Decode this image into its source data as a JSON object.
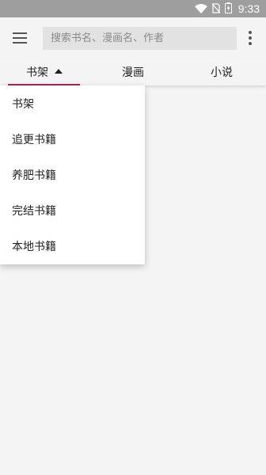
{
  "status_bar": {
    "time": "9:33",
    "icons": [
      "wifi-icon",
      "no-sim-icon",
      "battery-icon"
    ]
  },
  "app_bar": {
    "menu_icon": "hamburger-icon",
    "search_placeholder": "搜索书名、漫画名、作者",
    "search_value": "",
    "more_icon": "more-vert-icon"
  },
  "tabs": [
    {
      "label": "书架",
      "active": true
    },
    {
      "label": "漫画",
      "active": false
    },
    {
      "label": "小说",
      "active": false
    }
  ],
  "dropdown": {
    "items": [
      {
        "label": "书架"
      },
      {
        "label": "追更书籍"
      },
      {
        "label": "养肥书籍"
      },
      {
        "label": "完结书籍"
      },
      {
        "label": "本地书籍"
      }
    ]
  },
  "colors": {
    "status_bar": "#9e9e9e",
    "background": "#f4f4f4",
    "accent": "#b2225a",
    "search_bg": "#e2e2e2"
  }
}
